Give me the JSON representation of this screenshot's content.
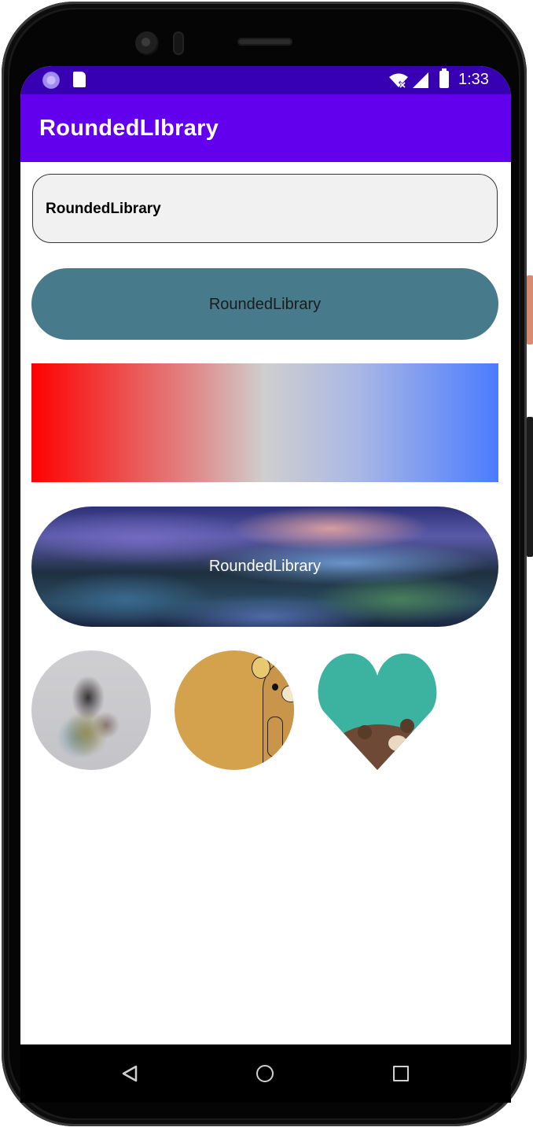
{
  "status_bar": {
    "time": "1:33",
    "icons": [
      "sync-icon",
      "sd-card-icon",
      "wifi-icon",
      "signal-icon",
      "battery-icon"
    ],
    "background": "#3700b3"
  },
  "app_bar": {
    "title": "RoundedLIbrary",
    "background": "#6200ee"
  },
  "main": {
    "button_outlined": {
      "label": "RoundedLibrary"
    },
    "button_filled": {
      "label": "RoundedLibrary",
      "background": "#477a8a"
    },
    "gradient_box": {
      "colors": [
        "#ff0000",
        "#cfcfcf",
        "#4b7cff"
      ]
    },
    "button_image_background": {
      "label": "RoundedLibrary"
    },
    "images": [
      {
        "name": "circle-photo"
      },
      {
        "name": "circle-cartoon-bear"
      },
      {
        "name": "heart-shape-image",
        "color": "#3bb3a0"
      }
    ]
  },
  "nav_bar": {
    "icons": [
      "back-icon",
      "home-icon",
      "recents-icon"
    ]
  }
}
